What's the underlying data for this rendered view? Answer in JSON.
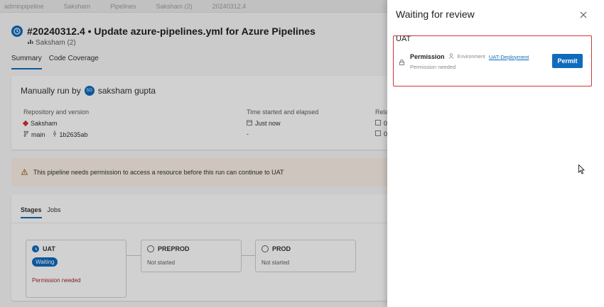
{
  "breadcrumb": [
    "adminpipeline",
    "Saksham",
    "Pipelines",
    "Saksham (2)",
    "20240312.4"
  ],
  "run": {
    "title": "#20240312.4 • Update azure-pipelines.yml for Azure Pipelines",
    "pipeline": "Saksham (2)"
  },
  "tabs": [
    "Summary",
    "Code Coverage"
  ],
  "summary": {
    "manual_prefix": "Manually run by",
    "user_initials": "SG",
    "user_name": "saksham gupta",
    "repo_label": "Repository and version",
    "repo_name": "Saksham",
    "branch": "main",
    "commit": "1b2635ab",
    "time_label": "Time started and elapsed",
    "time_started": "Just now",
    "elapsed": "-",
    "related_label": "Rela",
    "related_1": "0",
    "related_2": "0"
  },
  "warning": {
    "text": "This pipeline needs permission to access a resource before this run can continue to UAT"
  },
  "stages_card": {
    "tabs": [
      "Stages",
      "Jobs"
    ],
    "stages": [
      {
        "name": "UAT",
        "badge": "Waiting",
        "status": "Permission needed"
      },
      {
        "name": "PREPROD",
        "status": "Not started"
      },
      {
        "name": "PROD",
        "status": "Not started"
      }
    ]
  },
  "panel": {
    "title": "Waiting for review",
    "stage": "UAT",
    "item_title": "Permission",
    "env_label": "Environment",
    "env_link": "UAT-Deployment",
    "item_status": "Permission needed",
    "permit_label": "Permit"
  },
  "colors": {
    "accent": "#0f6cbd",
    "error": "#d13438",
    "warning_bg": "#faf1e8"
  }
}
